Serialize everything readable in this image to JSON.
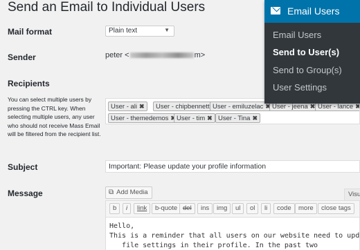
{
  "page": {
    "title": "Send an Email to Individual Users"
  },
  "fields": {
    "mail_format": {
      "label": "Mail format",
      "value": "Plain text"
    },
    "sender": {
      "label": "Sender",
      "prefix": "peter <",
      "suffix": "m>"
    },
    "recipients": {
      "label": "Recipients",
      "help": "You can select multiple users by pressing the CTRL key. When selecting multiple users, any user who should not receive Mass Email will be filtered from the recipient list.",
      "tokens": [
        "User - ali",
        "User - chipbennett",
        "User - emiluzelac",
        "User - jeena",
        "User - lance",
        "User - themedemos",
        "User - tim",
        "User - Tina"
      ],
      "remove_glyph": "✖"
    },
    "subject": {
      "label": "Subject",
      "value": "Important: Please update your profile information"
    },
    "message": {
      "label": "Message",
      "add_media": "Add Media",
      "visual_tab": "Visu",
      "toolbar": [
        "b",
        "i",
        "link",
        "b-quote",
        "del",
        "ins",
        "img",
        "ul",
        "ol",
        "li",
        "code",
        "more",
        "close tags"
      ],
      "lines": [
        "Hello,",
        "",
        "This is a reminder that all users on our website need to update social me",
        "   file settings in their profile. In the past two"
      ]
    }
  },
  "menu": {
    "header": "Email Users",
    "icon": "envelope-icon",
    "items": [
      "Email Users",
      "Send to User(s)",
      "Send to Group(s)",
      "User Settings"
    ],
    "active_index": 1
  },
  "colors": {
    "accent": "#0073aa",
    "menu_bg": "#32373c",
    "page_bg": "#f1f1f1"
  }
}
